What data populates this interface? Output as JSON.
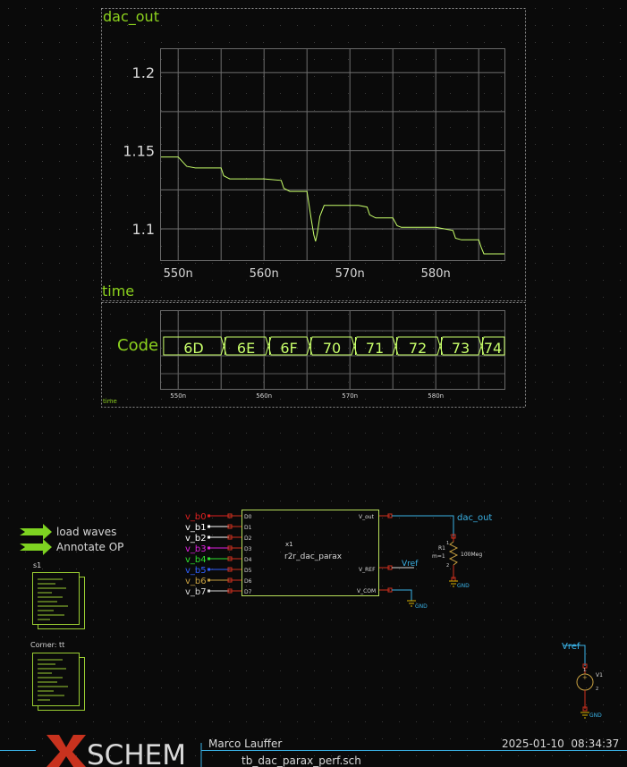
{
  "colors": {
    "background": "#0a0a0a",
    "grid_dots": "#3a3a3a",
    "graph_border": "#6a6a6a",
    "graph_grid": "#7a7a7a",
    "wave": "#c8ff6a",
    "label_green": "#8cd21e",
    "wire_cyan": "#3ab2e6",
    "instance_box": "#b8e05a",
    "pin_red": "#d0301e",
    "text_light": "#d8d8d8",
    "b0": "#e02020",
    "b1": "#ffffff",
    "b2": "#ffffff",
    "b3": "#e020e0",
    "b4": "#2ee02e",
    "b5": "#3060ff",
    "b6": "#c8a040",
    "b7": "#d8d8d8"
  },
  "graph_top": {
    "signal_label": "dac_out",
    "x_axis_label": "time",
    "chart_data": {
      "type": "line",
      "series": [
        {
          "name": "dac_out",
          "x": [
            548,
            549,
            550,
            551,
            552,
            553,
            554,
            555,
            555.3,
            556,
            558,
            560,
            562,
            562.3,
            563,
            565,
            565.2,
            565.5,
            565.8,
            566,
            566.2,
            566.5,
            567,
            568,
            570,
            571,
            572,
            572.3,
            573,
            575,
            575.5,
            576,
            578,
            580,
            581,
            582,
            582.3,
            583,
            585,
            585.3,
            585.6,
            586,
            588
          ],
          "y": [
            1.146,
            1.146,
            1.146,
            1.14,
            1.139,
            1.139,
            1.139,
            1.139,
            1.134,
            1.132,
            1.132,
            1.132,
            1.131,
            1.126,
            1.124,
            1.124,
            1.117,
            1.106,
            1.096,
            1.092,
            1.097,
            1.108,
            1.115,
            1.115,
            1.115,
            1.115,
            1.114,
            1.109,
            1.107,
            1.107,
            1.102,
            1.101,
            1.101,
            1.101,
            1.1,
            1.099,
            1.094,
            1.093,
            1.093,
            1.088,
            1.084,
            1.084,
            1.084
          ]
        }
      ],
      "title": "dac_out",
      "xlabel": "time",
      "x_ticks": [
        "550n",
        "560n",
        "570n",
        "580n"
      ],
      "y_ticks": [
        "1.2",
        "1.15",
        "1.1"
      ],
      "xlim": [
        548,
        588
      ],
      "ylim": [
        1.08,
        1.215
      ],
      "grid": true
    }
  },
  "graph_bottom": {
    "bus_label": "Code",
    "x_axis_label": "time",
    "x_ticks": [
      "550n",
      "560n",
      "570n",
      "580n"
    ],
    "xlim": [
      548,
      588
    ],
    "codes": [
      {
        "label": "6D",
        "start": 548.3,
        "end": 555.3
      },
      {
        "label": "6E",
        "start": 555.3,
        "end": 560.5
      },
      {
        "label": "6F",
        "start": 560.5,
        "end": 565.3
      },
      {
        "label": "70",
        "start": 565.3,
        "end": 570.5
      },
      {
        "label": "71",
        "start": 570.5,
        "end": 575.3
      },
      {
        "label": "72",
        "start": 575.3,
        "end": 580.5
      },
      {
        "label": "73",
        "start": 580.5,
        "end": 585.3
      },
      {
        "label": "74",
        "start": 585.3,
        "end": 588
      }
    ]
  },
  "launchers": {
    "load_waves": "load waves",
    "annotate_op": "Annotate OP"
  },
  "sheets": {
    "s1_label": "s1",
    "corner_label": "Corner: tt"
  },
  "instance": {
    "ref": "x1",
    "name": "r2r_dac_parax",
    "inputs": [
      {
        "net": "v_b0",
        "pin": "D0",
        "color_key": "b0"
      },
      {
        "net": "v_b1",
        "pin": "D1",
        "color_key": "b1"
      },
      {
        "net": "v_b2",
        "pin": "D2",
        "color_key": "b2"
      },
      {
        "net": "v_b3",
        "pin": "D3",
        "color_key": "b3"
      },
      {
        "net": "v_b4",
        "pin": "D4",
        "color_key": "b4"
      },
      {
        "net": "v_b5",
        "pin": "D5",
        "color_key": "b5"
      },
      {
        "net": "v_b6",
        "pin": "D6",
        "color_key": "b6"
      },
      {
        "net": "v_b7",
        "pin": "D7",
        "color_key": "b7"
      }
    ],
    "out_pins": {
      "v_out": "V_out",
      "v_ref": "V_REF",
      "v_com": "V_COM"
    }
  },
  "nets": {
    "dac_out": "dac_out",
    "vref": "Vref",
    "vref_src": "Vref",
    "gnd": "GND"
  },
  "resistor": {
    "ref": "R1",
    "mult": "m=1",
    "value": "100Meg",
    "pin1": "1",
    "pin2": "2"
  },
  "vsource": {
    "ref": "V1",
    "pin1": "1",
    "pin2": "2"
  },
  "title_block": {
    "logo_x": "X",
    "logo_text": "SCHEM",
    "author": "Marco Lauffer",
    "datetime": "2025-01-10  08:34:37",
    "filename": "tb_dac_parax_perf.sch"
  }
}
